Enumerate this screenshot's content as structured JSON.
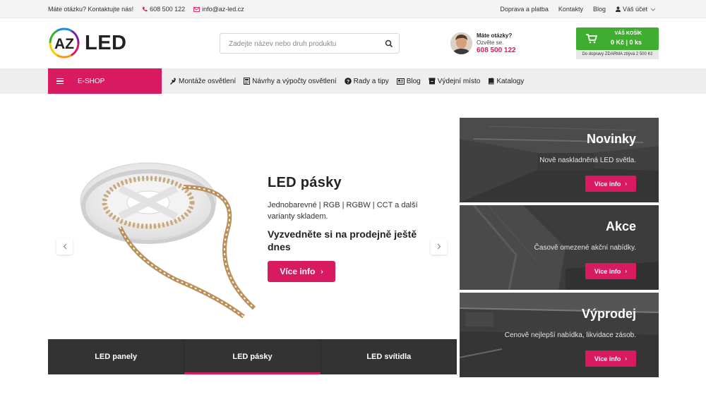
{
  "topbar": {
    "question": "Máte otázku? Kontaktujte nás!",
    "phone": "608 500 122",
    "email": "info@az-led.cz",
    "links": [
      "Doprava a platba",
      "Kontakty",
      "Blog"
    ],
    "account": "Váš účet"
  },
  "header": {
    "logo_az": "AZ",
    "logo_led": "LED",
    "search_placeholder": "Zadejte název nebo druh produktu",
    "contact_question": "Máte otázky?",
    "contact_call": "Ozvěte se.",
    "contact_phone": "608 500 122",
    "cart_title": "VÁŠ KOŠÍK",
    "cart_value": "0 Kč | 0 ks",
    "ship_note": "Do dopravy ZDARMA zbývá 2 500 Kč"
  },
  "nav": {
    "eshop": "E-SHOP",
    "items": [
      {
        "label": "Montáže osvětlení",
        "icon": "wrench-icon"
      },
      {
        "label": "Návrhy a výpočty osvětlení",
        "icon": "calculator-icon"
      },
      {
        "label": "Rady a tipy",
        "icon": "question-circle-icon"
      },
      {
        "label": "Blog",
        "icon": "newspaper-icon"
      },
      {
        "label": "Výdejní místo",
        "icon": "box-icon"
      },
      {
        "label": "Katalogy",
        "icon": "book-icon"
      }
    ]
  },
  "hero": {
    "title": "LED pásky",
    "description": "Jednobarevné | RGB | RGBW | CCT a další varianty skladem.",
    "subtitle": "Vyzvedněte si na prodejně ještě dnes",
    "cta": "Více info"
  },
  "tabs": [
    {
      "label": "LED panely",
      "active": false
    },
    {
      "label": "LED pásky",
      "active": true
    },
    {
      "label": "LED svítidla",
      "active": false
    }
  ],
  "tiles": [
    {
      "title": "Novinky",
      "text": "Nově naskladněná LED světla.",
      "button": "Více info"
    },
    {
      "title": "Akce",
      "text": "Časově omezené akční nabídky.",
      "button": "Více info"
    },
    {
      "title": "Výprodej",
      "text": "Cenově nejlepší nabídka, likvidace zásob.",
      "button": "Více info"
    }
  ],
  "colors": {
    "brand_pink": "#d81b60",
    "cart_green": "#3fad2f",
    "tab_dark": "#333333"
  }
}
